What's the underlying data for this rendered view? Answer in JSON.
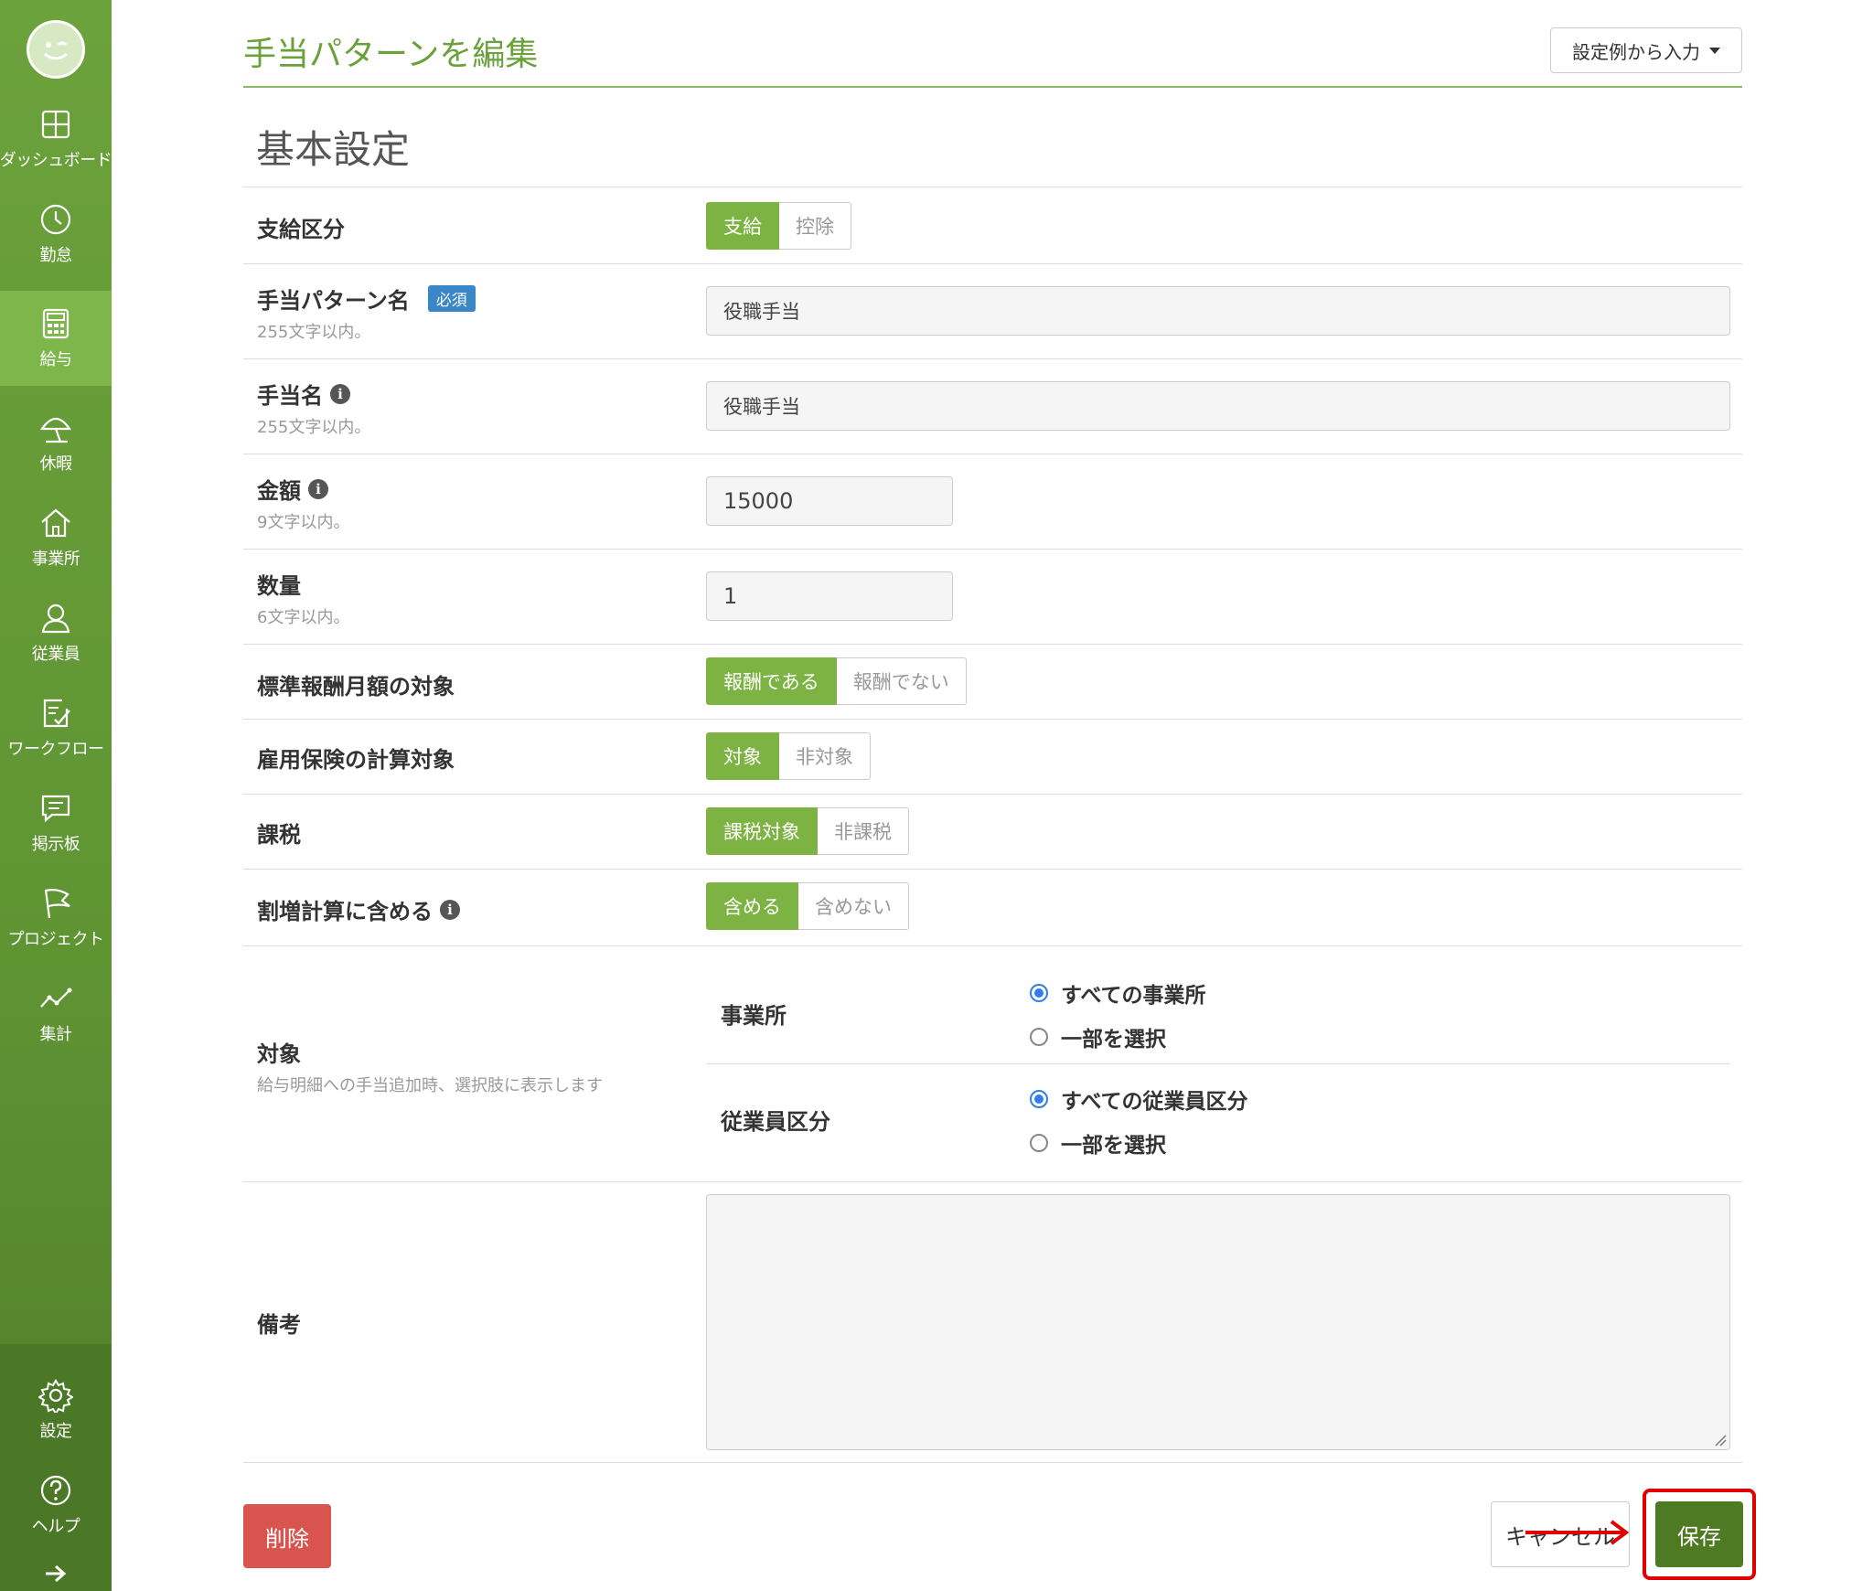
{
  "colors": {
    "sidebar": "#5f9433",
    "accent": "#7cb342",
    "title": "#6aa13a",
    "danger": "#d9534f",
    "save": "#4e7a24",
    "highlight": "#e00000",
    "radio": "#2d7ef7"
  },
  "sidebar": {
    "items": [
      {
        "label": "ダッシュボード",
        "icon": "dashboard-icon"
      },
      {
        "label": "勤怠",
        "icon": "clock-icon"
      },
      {
        "label": "給与",
        "icon": "calculator-icon"
      },
      {
        "label": "休暇",
        "icon": "umbrella-icon"
      },
      {
        "label": "事業所",
        "icon": "home-icon"
      },
      {
        "label": "従業員",
        "icon": "person-icon"
      },
      {
        "label": "ワークフロー",
        "icon": "checklist-icon"
      },
      {
        "label": "掲示板",
        "icon": "chat-icon"
      },
      {
        "label": "プロジェクト",
        "icon": "flag-icon"
      },
      {
        "label": "集計",
        "icon": "line-chart-icon"
      }
    ],
    "active": "給与",
    "bottom": [
      {
        "label": "設定",
        "icon": "gear-icon"
      },
      {
        "label": "ヘルプ",
        "icon": "help-icon"
      }
    ],
    "expand_icon": "arrow-right-icon"
  },
  "header": {
    "title": "手当パターンを編集",
    "example_button": "設定例から入力"
  },
  "section_title": "基本設定",
  "form": {
    "pay_type": {
      "label": "支給区分",
      "options": [
        "支給",
        "控除"
      ],
      "selected": "支給"
    },
    "pattern_name": {
      "label": "手当パターン名",
      "badge": "必須",
      "hint": "255文字以内。",
      "value": "役職手当"
    },
    "allowance_name": {
      "label": "手当名",
      "hint": "255文字以内。",
      "value": "役職手当"
    },
    "amount": {
      "label": "金額",
      "hint": "9文字以内。",
      "value": "15000"
    },
    "quantity": {
      "label": "数量",
      "hint": "6文字以内。",
      "value": "1"
    },
    "standard_remuneration": {
      "label": "標準報酬月額の対象",
      "options": [
        "報酬である",
        "報酬でない"
      ],
      "selected": "報酬である"
    },
    "employment_insurance": {
      "label": "雇用保険の計算対象",
      "options": [
        "対象",
        "非対象"
      ],
      "selected": "対象"
    },
    "taxation": {
      "label": "課税",
      "options": [
        "課税対象",
        "非課税"
      ],
      "selected": "課税対象"
    },
    "overtime": {
      "label": "割増計算に含める",
      "options": [
        "含める",
        "含めない"
      ],
      "selected": "含める"
    },
    "target": {
      "label": "対象",
      "hint": "給与明細への手当追加時、選択肢に表示します",
      "office": {
        "label": "事業所",
        "options": [
          "すべての事業所",
          "一部を選択"
        ],
        "selected": "すべての事業所"
      },
      "employee_type": {
        "label": "従業員区分",
        "options": [
          "すべての従業員区分",
          "一部を選択"
        ],
        "selected": "すべての従業員区分"
      }
    },
    "remarks": {
      "label": "備考",
      "value": ""
    }
  },
  "actions": {
    "delete": "削除",
    "cancel": "キャンセル",
    "save": "保存"
  }
}
